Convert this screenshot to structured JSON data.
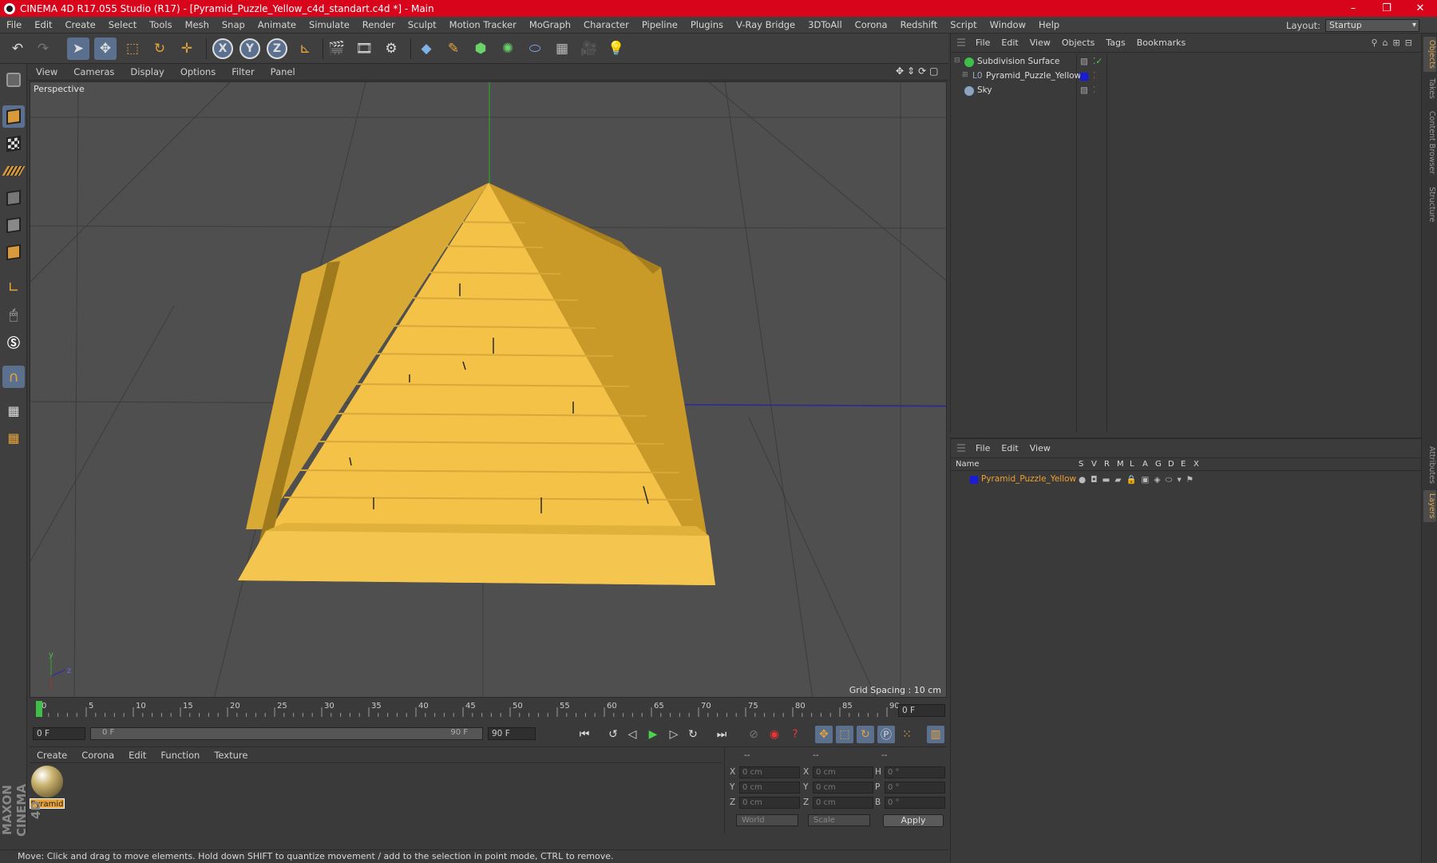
{
  "window": {
    "title": "CINEMA 4D R17.055 Studio (R17) - [Pyramid_Puzzle_Yellow_c4d_standart.c4d *] - Main",
    "controls": [
      "–",
      "❐",
      "✕"
    ]
  },
  "menubar": {
    "items": [
      "File",
      "Edit",
      "Create",
      "Select",
      "Tools",
      "Mesh",
      "Snap",
      "Animate",
      "Simulate",
      "Render",
      "Sculpt",
      "Motion Tracker",
      "MoGraph",
      "Character",
      "Pipeline",
      "Plugins",
      "V-Ray Bridge",
      "3DToAll",
      "Corona",
      "Redshift",
      "Script",
      "Window",
      "Help"
    ],
    "layout_label": "Layout:",
    "layout_value": "Startup"
  },
  "toolbar": {
    "axis_x": "X",
    "axis_y": "Y",
    "axis_z": "Z"
  },
  "viewport": {
    "menu": [
      "View",
      "Cameras",
      "Display",
      "Options",
      "Filter",
      "Panel"
    ],
    "label": "Perspective",
    "grid_spacing": "Grid Spacing : 10 cm",
    "axis_y_label": "y",
    "axis_z_label": "z"
  },
  "timeline": {
    "ticks": [
      "0",
      "5",
      "10",
      "15",
      "20",
      "25",
      "30",
      "35",
      "40",
      "45",
      "50",
      "55",
      "60",
      "65",
      "70",
      "75",
      "80",
      "85",
      "90"
    ],
    "current_frame_box": "0 F"
  },
  "transport": {
    "start_field": "0 F",
    "slider_start": "0 F",
    "slider_end": "90 F",
    "end_field": "90 F"
  },
  "material_manager": {
    "menu": [
      "Create",
      "Corona",
      "Edit",
      "Function",
      "Texture"
    ],
    "materials": [
      {
        "name": "Pyramid"
      }
    ]
  },
  "coordinates": {
    "headers": [
      "--",
      "--",
      "--"
    ],
    "rows": [
      {
        "l1": "X",
        "v1": "0 cm",
        "l2": "X",
        "v2": "0 cm",
        "l3": "H",
        "v3": "0 °"
      },
      {
        "l1": "Y",
        "v1": "0 cm",
        "l2": "Y",
        "v2": "0 cm",
        "l3": "P",
        "v3": "0 °"
      },
      {
        "l1": "Z",
        "v1": "0 cm",
        "l2": "Z",
        "v2": "0 cm",
        "l3": "B",
        "v3": "0 °"
      }
    ],
    "mode_world": "World",
    "mode_scale": "Scale",
    "apply": "Apply"
  },
  "status": {
    "text": "Move: Click and drag to move elements. Hold down SHIFT to quantize movement / add to the selection in point mode, CTRL to remove."
  },
  "maxon_logo": "MAXON CINEMA 4D",
  "object_manager": {
    "menu": [
      "File",
      "Edit",
      "View",
      "Objects",
      "Tags",
      "Bookmarks"
    ],
    "objects": [
      {
        "name": "Subdivision Surface",
        "color": "#3fbf4a"
      },
      {
        "name": "Pyramid_Puzzle_Yellow",
        "color": "#9aa9c4"
      },
      {
        "name": "Sky",
        "color": "#8ca3c2"
      }
    ]
  },
  "layer_manager": {
    "menu": [
      "File",
      "Edit",
      "View"
    ],
    "columns": [
      "Name",
      "S",
      "V",
      "R",
      "M",
      "L",
      "A",
      "G",
      "D",
      "E",
      "X"
    ],
    "layers": [
      {
        "name": "Pyramid_Puzzle_Yellow",
        "color": "#1a1adb"
      }
    ]
  },
  "side_tabs": [
    "Objects",
    "Takes",
    "Content Browser",
    "Structure",
    "Attributes",
    "Layers"
  ],
  "colors": {
    "title_bar": "#d7041b",
    "accent_blue": "#5b6f8e",
    "pyramid_yellow": "#f3c247",
    "layer_name_orange": "#f0a030"
  }
}
